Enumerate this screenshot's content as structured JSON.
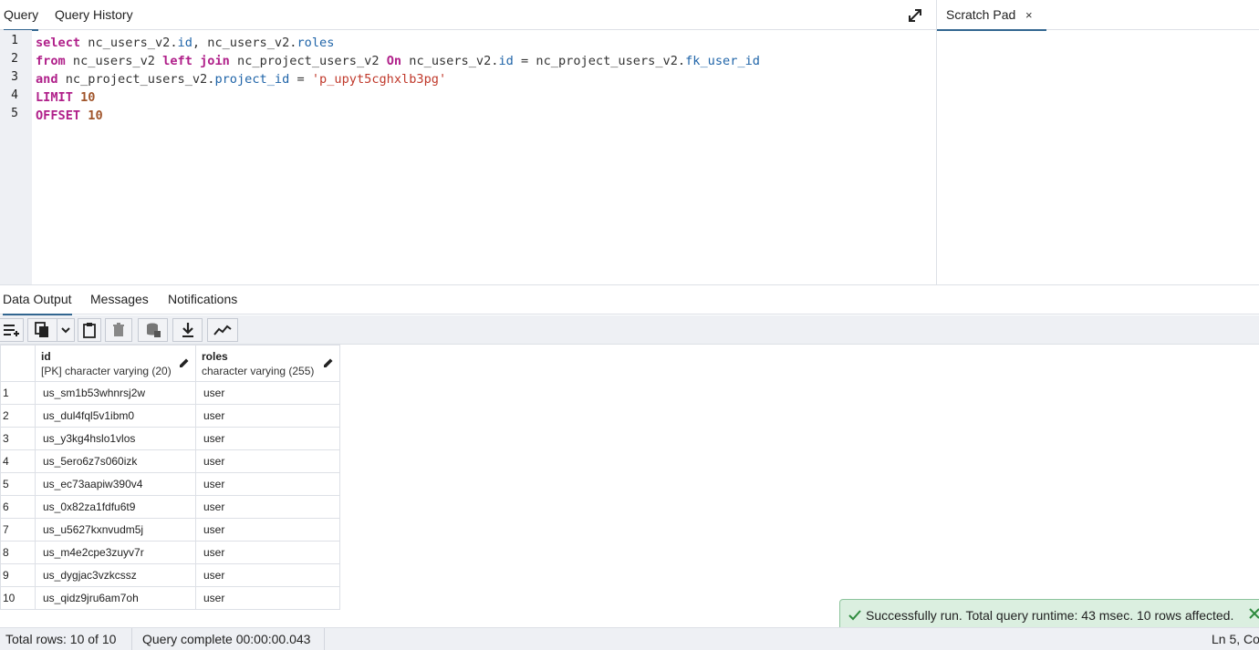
{
  "top_tabs": [
    "Query",
    "Query History"
  ],
  "scratch_pad": {
    "label": "Scratch Pad",
    "close": "×"
  },
  "editor": {
    "line_numbers": [
      "1",
      "2",
      "3",
      "4",
      "5"
    ],
    "tokens": {
      "l1_kw": "select",
      "l1_a": " nc_users_v2.",
      "l1_b": "id",
      "l1_c": ", nc_users_v2.",
      "l1_d": "roles",
      "l2_kw1": "from",
      "l2_a": " nc_users_v2 ",
      "l2_kw2": "left join",
      "l2_b": " nc_project_users_v2 ",
      "l2_kw3": "On",
      "l2_c": " nc_users_v2.",
      "l2_d": "id",
      "l2_e": " = nc_project_users_v2.",
      "l2_f": "fk_user_id",
      "l3_kw": "and",
      "l3_a": " nc_project_users_v2.",
      "l3_b": "project_id",
      "l3_c": " = ",
      "l3_str": "'p_upyt5cghxlb3pg'",
      "l4_kw": "LIMIT",
      "l4_num": "10",
      "l5_kw": "OFFSET",
      "l5_num": "10"
    }
  },
  "output_tabs": [
    "Data Output",
    "Messages",
    "Notifications"
  ],
  "grid": {
    "columns": [
      {
        "name": "id",
        "type": "[PK] character varying (20)"
      },
      {
        "name": "roles",
        "type": "character varying (255)"
      }
    ],
    "rows": [
      {
        "n": "1",
        "id": "us_sm1b53whnrsj2w",
        "roles": "user"
      },
      {
        "n": "2",
        "id": "us_dul4fql5v1ibm0",
        "roles": "user"
      },
      {
        "n": "3",
        "id": "us_y3kg4hslo1vlos",
        "roles": "user"
      },
      {
        "n": "4",
        "id": "us_5ero6z7s060izk",
        "roles": "user"
      },
      {
        "n": "5",
        "id": "us_ec73aapiw390v4",
        "roles": "user"
      },
      {
        "n": "6",
        "id": "us_0x82za1fdfu6t9",
        "roles": "user"
      },
      {
        "n": "7",
        "id": "us_u5627kxnvudm5j",
        "roles": "user"
      },
      {
        "n": "8",
        "id": "us_m4e2cpe3zuyv7r",
        "roles": "user"
      },
      {
        "n": "9",
        "id": "us_dygjac3vzkcssz",
        "roles": "user"
      },
      {
        "n": "10",
        "id": "us_qidz9jru6am7oh",
        "roles": "user"
      }
    ]
  },
  "toast": {
    "text": "Successfully run. Total query runtime: 43 msec. 10 rows affected."
  },
  "status": {
    "total_rows": "Total rows: 10 of 10",
    "query_complete": "Query complete 00:00:00.043",
    "cursor": "Ln 5, Co"
  },
  "colors": {
    "accent": "#326690",
    "keyword": "#b0208a",
    "property": "#1f64a8",
    "string": "#c0392b",
    "number": "#a0542a",
    "success": "#2e8b3e"
  }
}
